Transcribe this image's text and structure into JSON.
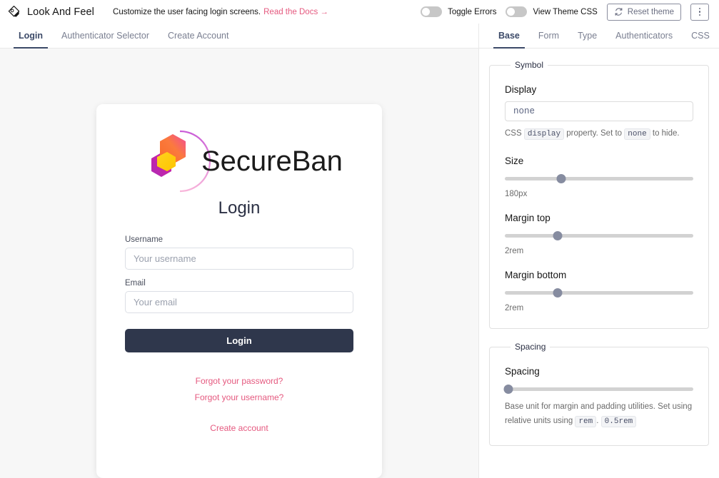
{
  "header": {
    "brand_icon": "paint-palette-icon",
    "title": "Look And Feel",
    "subtitle": "Customize the user facing login screens.",
    "docs_link": "Read the Docs →",
    "toggle_errors_label": "Toggle Errors",
    "toggle_errors_state": "off",
    "view_theme_css_label": "View Theme CSS",
    "view_theme_css_state": "off",
    "reset_theme_label": "Reset theme",
    "reset_icon": "refresh-icon",
    "kebab_icon": "kebab-menu-icon"
  },
  "left_tabs": {
    "items": [
      {
        "label": "Login",
        "active": true
      },
      {
        "label": "Authenticator Selector",
        "active": false
      },
      {
        "label": "Create Account",
        "active": false
      }
    ]
  },
  "right_tabs": {
    "items": [
      {
        "label": "Base",
        "active": true
      },
      {
        "label": "Form",
        "active": false
      },
      {
        "label": "Type",
        "active": false
      },
      {
        "label": "Authenticators",
        "active": false
      },
      {
        "label": "CSS",
        "active": false
      }
    ]
  },
  "preview": {
    "logo_text": "SecureBank",
    "heading": "Login",
    "fields": [
      {
        "label": "Username",
        "placeholder": "Your username",
        "value": ""
      },
      {
        "label": "Email",
        "placeholder": "Your email",
        "value": ""
      }
    ],
    "submit_label": "Login",
    "links": [
      "Forgot your password?",
      "Forgot your username?",
      "Create account"
    ]
  },
  "settings": {
    "symbol": {
      "legend": "Symbol",
      "display": {
        "label": "Display",
        "value": "none",
        "helper_pre": "CSS",
        "helper_code_1": "display",
        "helper_mid": "property. Set to",
        "helper_code_2": "none",
        "helper_post": "to hide."
      },
      "size": {
        "label": "Size",
        "value": "180px",
        "percent": 30
      },
      "margin_top": {
        "label": "Margin top",
        "value": "2rem",
        "percent": 28
      },
      "margin_bottom": {
        "label": "Margin bottom",
        "value": "2rem",
        "percent": 28
      }
    },
    "spacing": {
      "legend": "Spacing",
      "spacing": {
        "label": "Spacing",
        "helper_pre": "Base unit for margin and padding utilities. Set using relative units using",
        "helper_code_1": "rem",
        "helper_dot": ".",
        "helper_code_2": "0.5rem",
        "percent": 2
      }
    }
  },
  "colors": {
    "accent_pink": "#e5597f",
    "button_dark": "#2f374c",
    "tab_active": "#3c4a68",
    "slider_thumb": "#868ca0"
  }
}
